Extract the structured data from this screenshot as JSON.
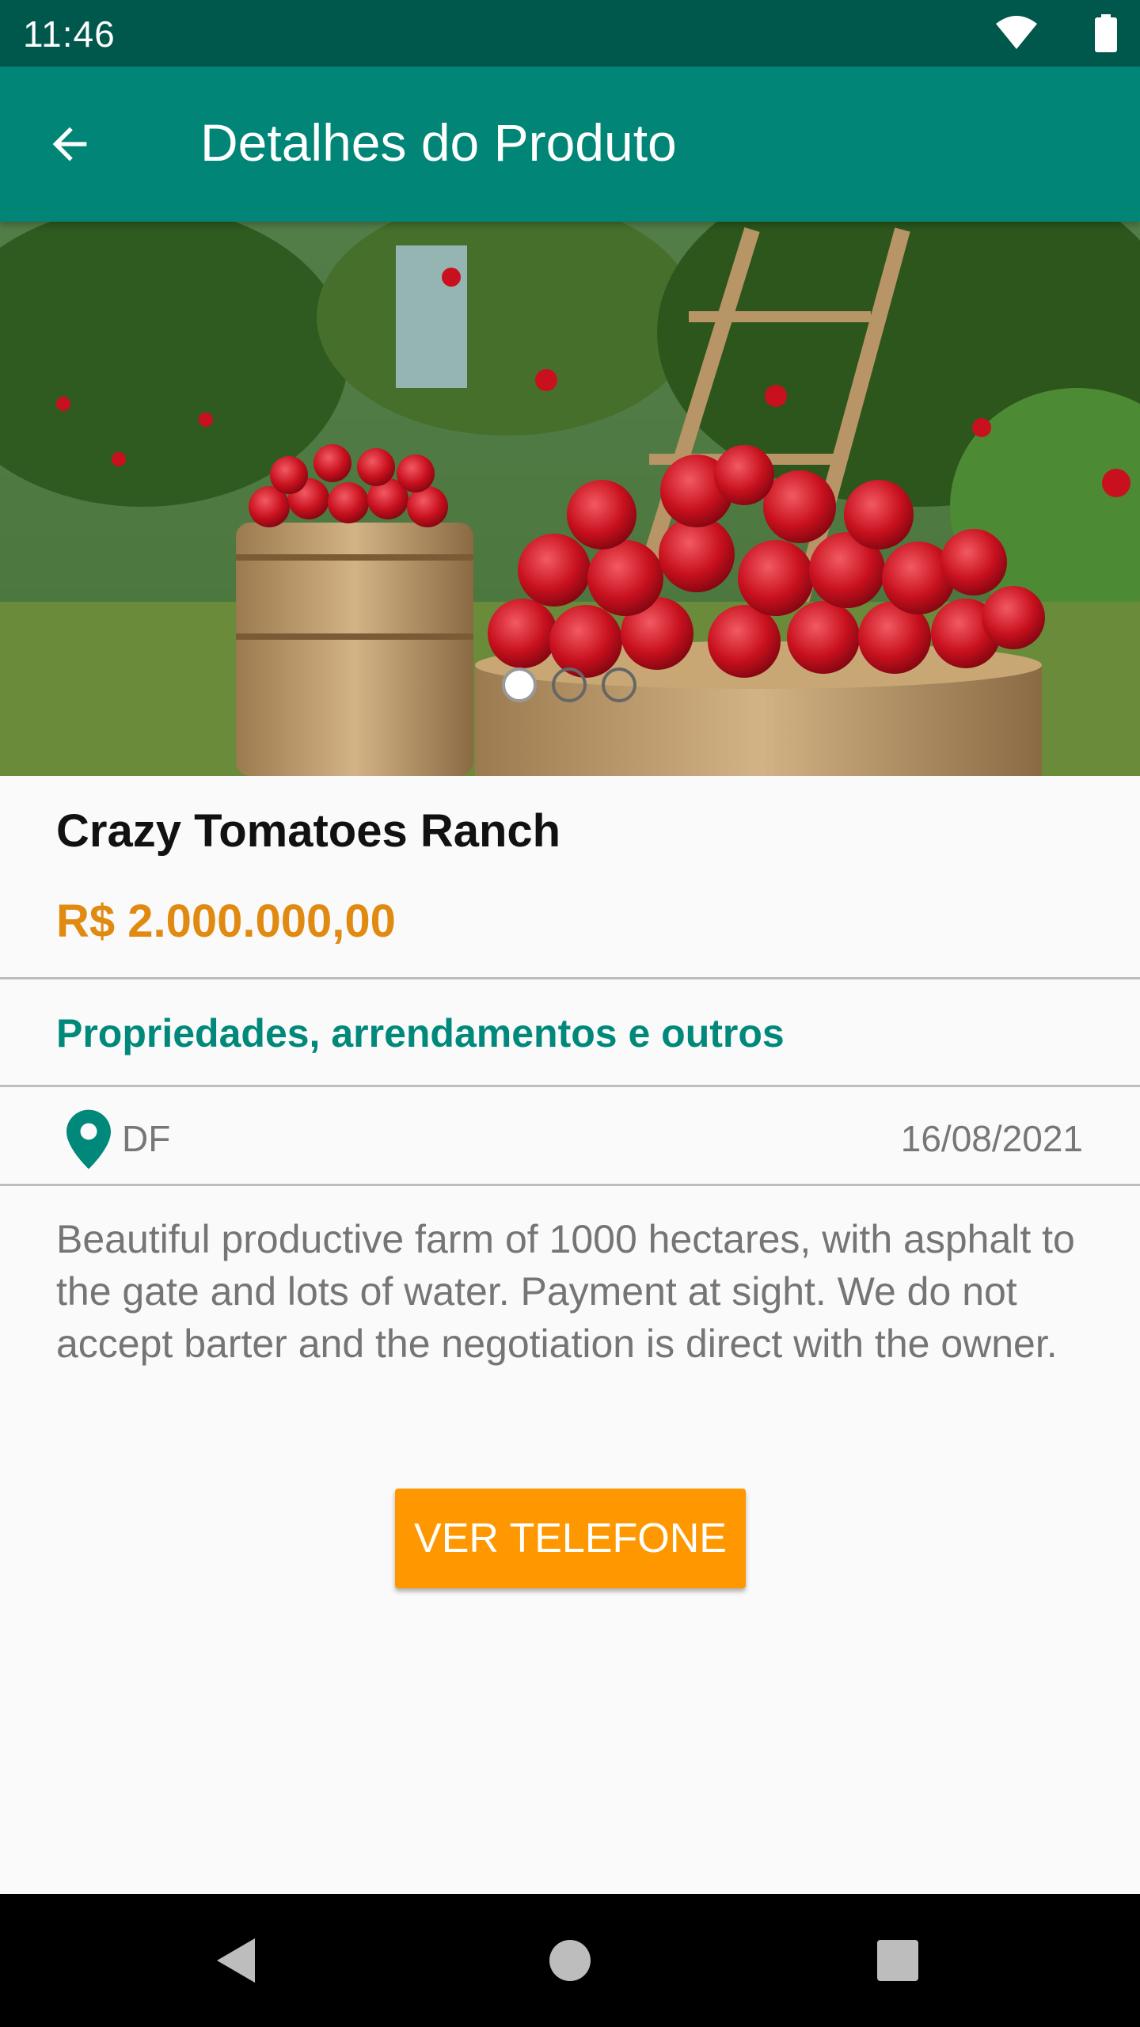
{
  "status_bar": {
    "time": "11:46"
  },
  "app_bar": {
    "title": "Detalhes do Produto",
    "back_icon": "arrow-back-icon"
  },
  "carousel": {
    "page_count": 3,
    "active_index": 0
  },
  "product": {
    "name": "Crazy Tomatoes Ranch",
    "price": "R$ 2.000.000,00",
    "category": "Propriedades, arrendamentos e outros",
    "location": "DF",
    "date": "16/08/2021",
    "description": "Beautiful productive farm of 1000 hectares, with asphalt to the gate and lots of water. Payment at sight. We do not accept barter and the negotiation is direct with the owner."
  },
  "actions": {
    "phone_button_label": "VER TELEFONE"
  },
  "colors": {
    "primary": "#008577",
    "primary_dark": "#00574b",
    "accent": "#ff9800",
    "price": "#e08a12",
    "category": "#00897b"
  }
}
